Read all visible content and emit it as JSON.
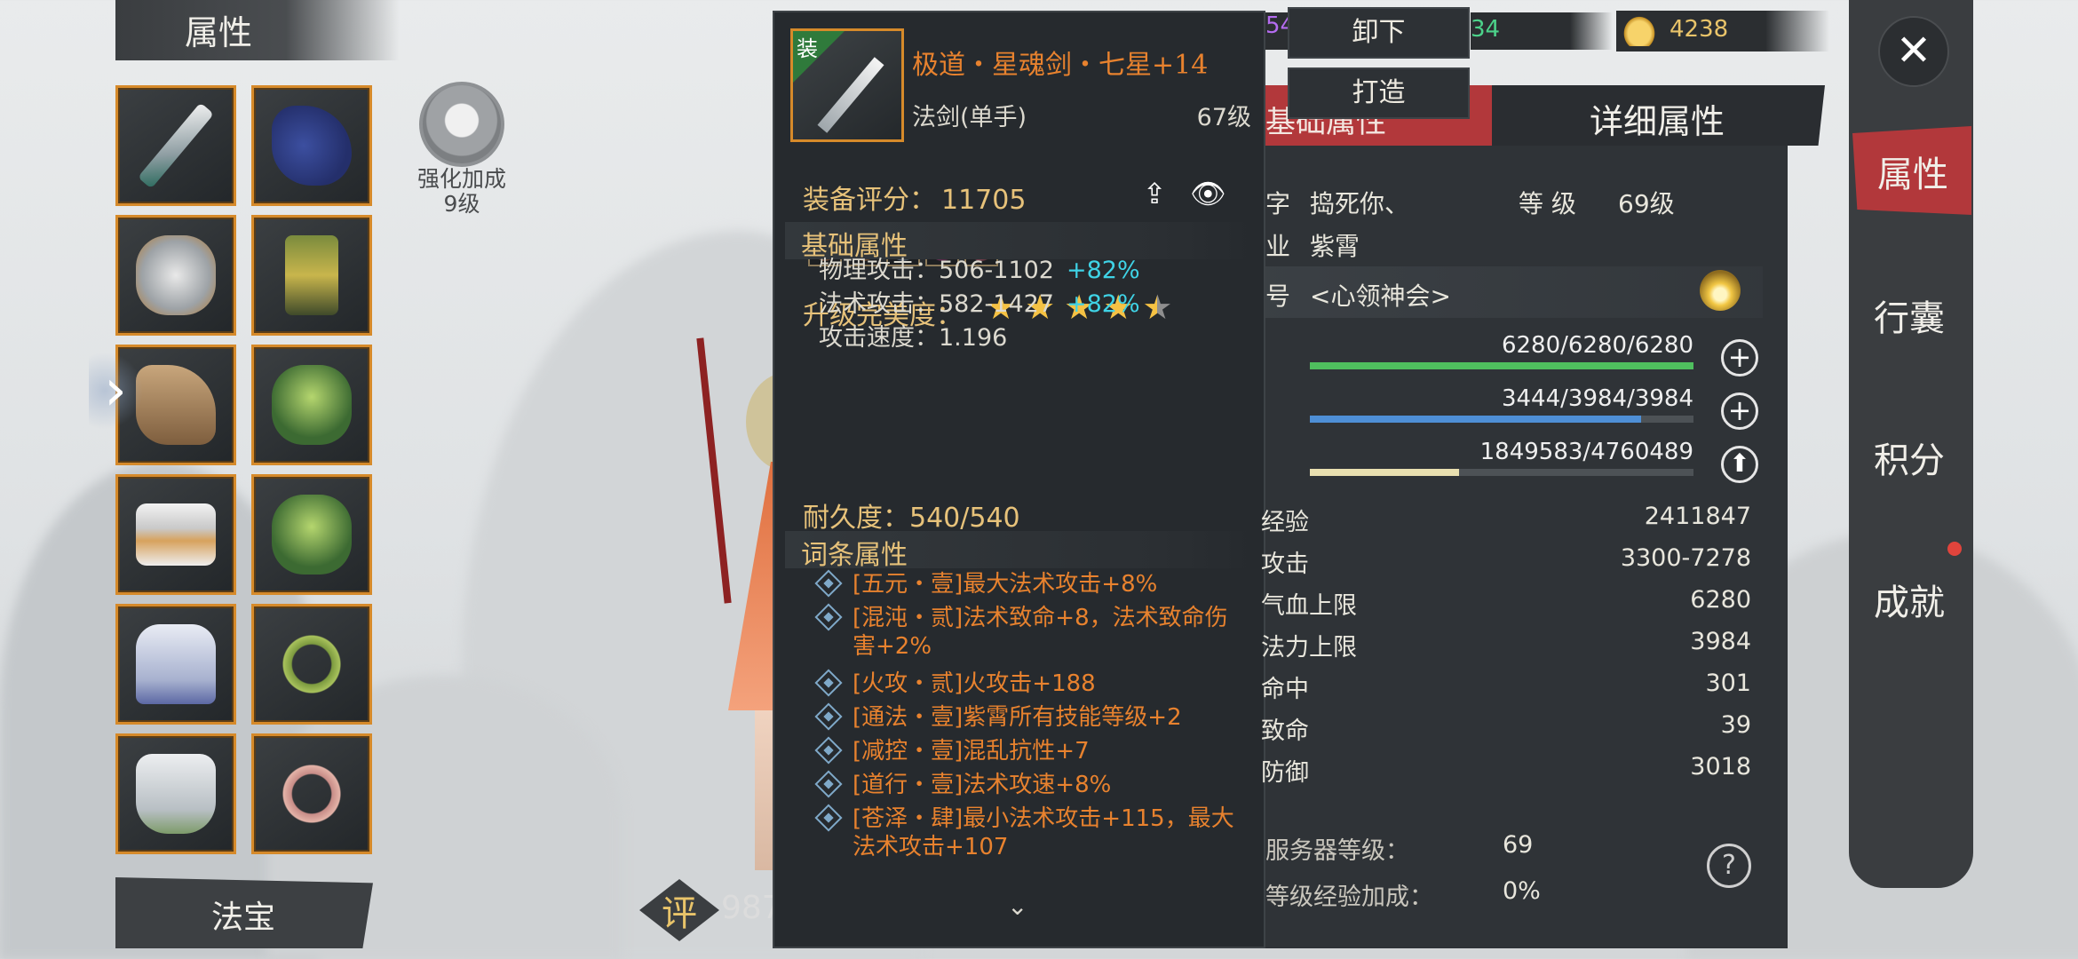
{
  "attributes_panel": {
    "title": "属性",
    "enhance_label": "强化加成",
    "enhance_level": "9级",
    "expand_arrow": "›",
    "fabao_label": "法宝"
  },
  "character_score": {
    "badge": "评",
    "value": "987"
  },
  "item_tooltip": {
    "equipped_tag": "装",
    "name": "极道・星魂剑・七星+14",
    "type": "法剑(单手)",
    "level": "67级",
    "score_label": "装备评分：",
    "score_value": "11705",
    "gem_colors": [
      "#c9835c",
      "#d2884e",
      "#7f95b8",
      "#9a3c7c",
      "#c6607a"
    ],
    "perfect_label": "升级完美度：",
    "stars": 4.5,
    "basic_section": "基础属性",
    "basic_stats": [
      {
        "label": "物理攻击：506-1102",
        "bonus": "+82%"
      },
      {
        "label": "法术攻击：582-1427",
        "bonus": "+82%"
      },
      {
        "label": "攻击速度：1.196",
        "bonus": ""
      }
    ],
    "durability": "耐久度：540/540",
    "affix_section": "词条属性",
    "affixes": [
      "[五元・壹]最大法术攻击+8%",
      "[混沌・贰]法术致命+8，法术致命伤害+2%",
      "[火攻・贰]火攻击+188",
      "[通法・壹]紫霄所有技能等级+2",
      "[减控・壹]混乱抗性+7",
      "[道行・壹]法术攻速+8%",
      "[苍泽・肆]最小法术攻击+115，最大法术攻击+107"
    ],
    "more_arrow": "⌄"
  },
  "actions": {
    "unequip": "卸下",
    "forge": "打造"
  },
  "resources": {
    "res1": "54",
    "res2": "34",
    "gold": "4238"
  },
  "stats_panel": {
    "tab_basic": "基础属性",
    "tab_detail": "详细属性",
    "name_label": "字",
    "name_value": "捣死你、",
    "level_label": "等 级",
    "level_value": "69级",
    "class_label": "业",
    "class_value": "紫霄",
    "title_label": "号",
    "title_value": "<心领神会>",
    "hp": {
      "text": "6280/6280/6280",
      "fill": 1.0,
      "color": "#4fbf5e"
    },
    "mp": {
      "text": "3444/3984/3984",
      "fill": 0.8645,
      "color": "#4e8fd6"
    },
    "exp": {
      "text": "1849583/4760489",
      "fill": 0.3885,
      "color": "#e8dfb0"
    },
    "rows": [
      {
        "label": "经验",
        "value": "2411847"
      },
      {
        "label": "攻击",
        "value": "3300-7278"
      },
      {
        "label": "气血上限",
        "value": "6280"
      },
      {
        "label": "法力上限",
        "value": "3984"
      },
      {
        "label": "命中",
        "value": "301"
      },
      {
        "label": "致命",
        "value": "39"
      },
      {
        "label": "防御",
        "value": "3018"
      }
    ],
    "server_level_label": "服务器等级：",
    "server_level_value": "69",
    "exp_bonus_label": "等级经验加成：",
    "exp_bonus_value": "0%",
    "help": "?"
  },
  "right_nav": {
    "close": "✕",
    "items": [
      "属性",
      "行囊",
      "积分",
      "成就"
    ]
  }
}
